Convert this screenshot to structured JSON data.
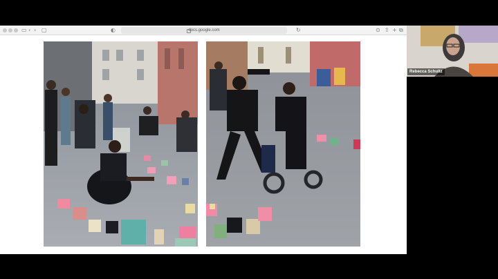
{
  "browser": {
    "url": "docs.google.com"
  },
  "video": {
    "participant_name": "Rebecca Schultz"
  },
  "colors": {
    "background": "#000000",
    "toolbar": "#f3f3f3",
    "slide": "#ffffff"
  }
}
